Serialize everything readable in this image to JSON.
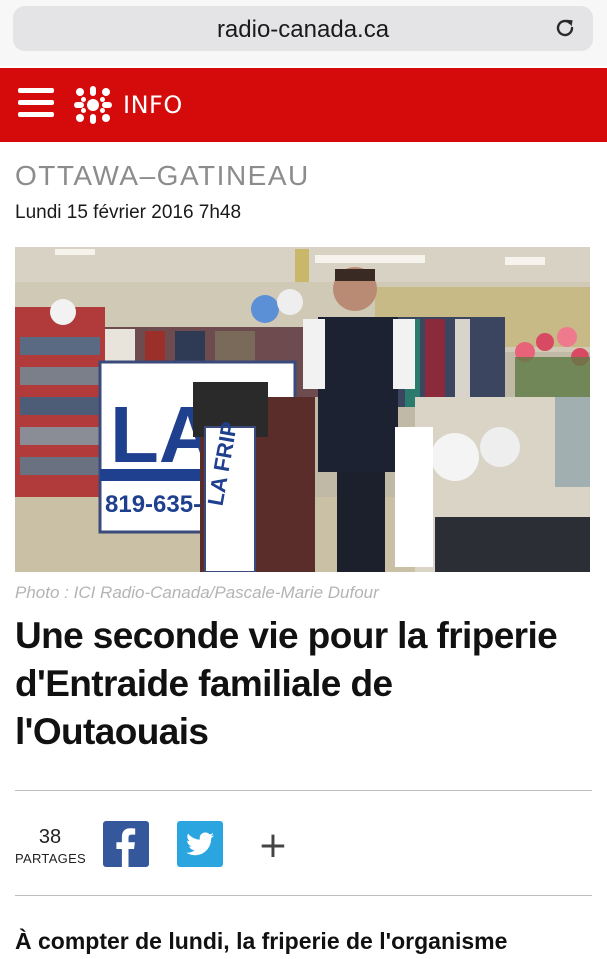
{
  "browser": {
    "url": "radio-canada.ca",
    "reload_icon": "reload-icon"
  },
  "header": {
    "menu_icon": "hamburger-menu-icon",
    "logo_icon": "radio-canada-gem-logo",
    "section_label": "INFO",
    "background_color": "#d50b0b"
  },
  "article": {
    "region": "OTTAWA–GATINEAU",
    "date": "Lundi 15 février 2016 7h48",
    "photo": {
      "description_icon": "article-photo",
      "sign_text_main": "LA F",
      "sign_phone": "819-635-88",
      "podium_sign_text": "LA FRIP"
    },
    "photo_credit": "Photo : ICI Radio-Canada/Pascale-Marie Dufour",
    "headline": "Une seconde vie pour la friperie d'Entraide familiale de l'Outaouais",
    "share": {
      "count": "38",
      "label": "PARTAGES",
      "facebook_icon": "facebook-icon",
      "twitter_icon": "twitter-icon",
      "more_label": "+",
      "facebook_color": "#34589b",
      "twitter_color": "#2aa5e0"
    },
    "lead": "À compter de lundi, la friperie de l'organisme"
  }
}
